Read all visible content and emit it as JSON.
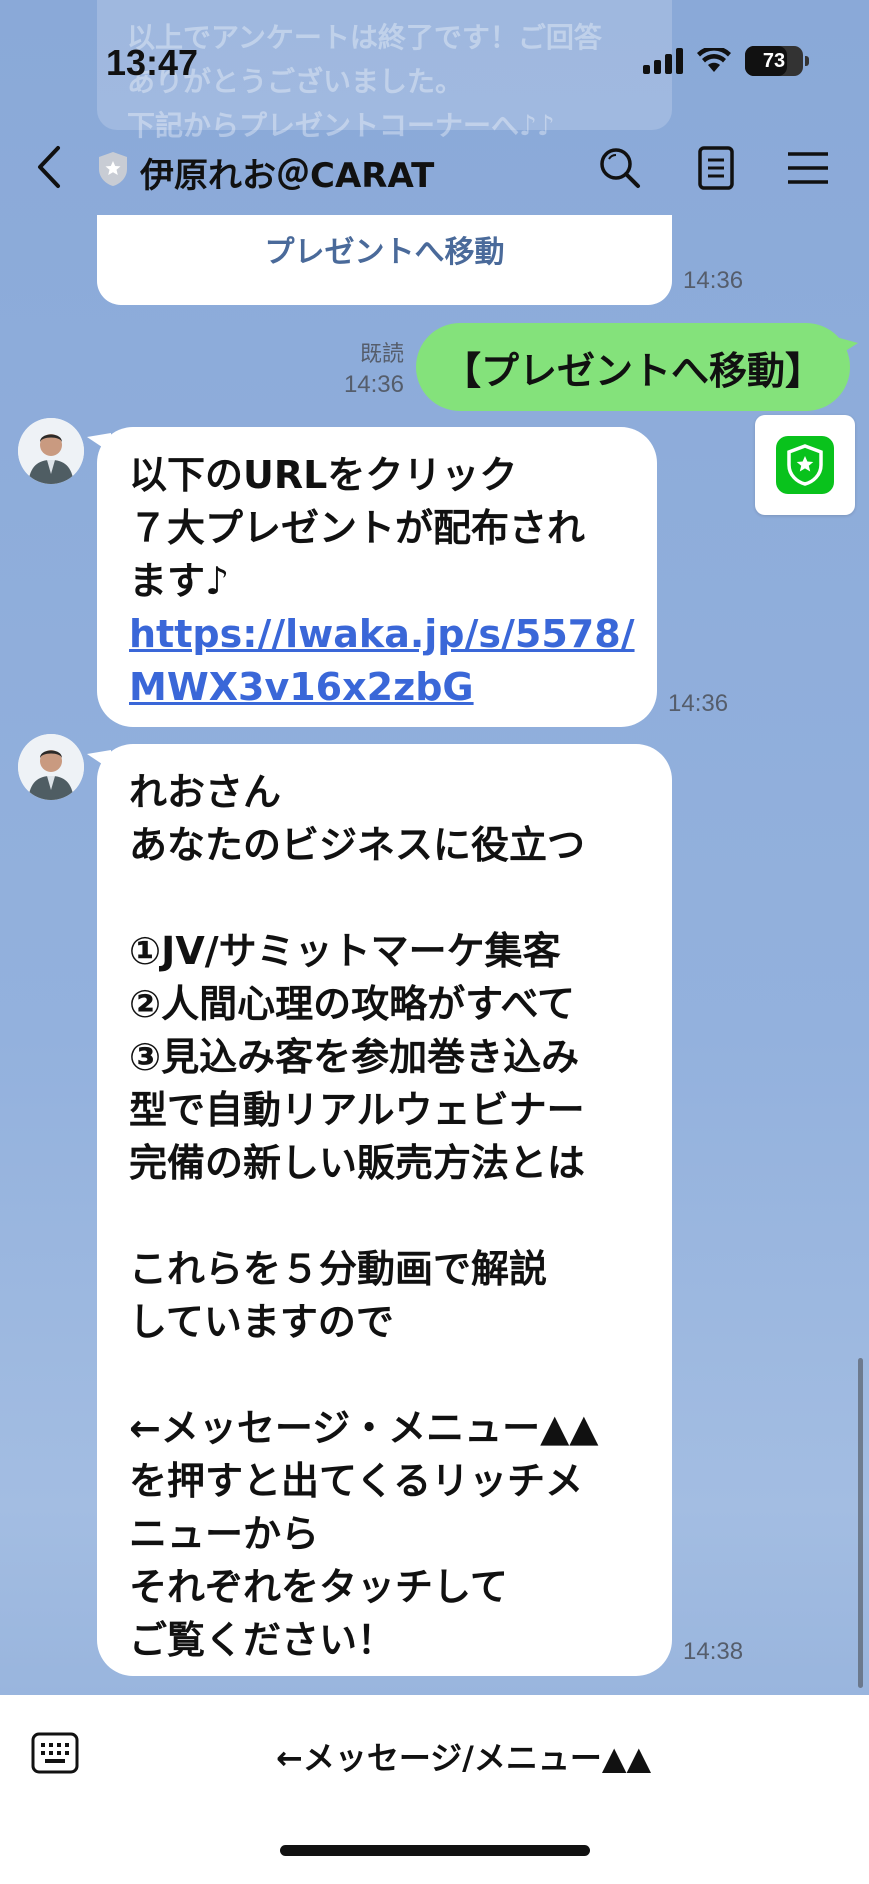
{
  "status_bar": {
    "time": "13:47",
    "battery": "73"
  },
  "background_preview": {
    "lines": "以上でアンケートは終了です！ご回答\nありがとうございました。\n下記からプレゼントコーナーへ♪♪"
  },
  "header": {
    "title": "伊原れお＠CARAT",
    "back_icon": "chevron-left-icon",
    "search_icon": "search-icon",
    "notes_icon": "notes-icon",
    "menu_icon": "hamburger-menu-icon"
  },
  "messages": {
    "top_link": "プレゼントへ移動",
    "top_time": "14:36",
    "mine": {
      "text": "【プレゼントへ移動】",
      "read_label": "既読",
      "time": "14:36"
    },
    "msg1": {
      "lines": [
        "以下のURLをクリック",
        "７大プレゼントが配布され",
        "ます♪"
      ],
      "link_lines": [
        "https://lwaka.jp/s/5578/",
        "MWX3v16x2zbG"
      ],
      "time": "14:36"
    },
    "msg2": {
      "lines": [
        "れおさん",
        "あなたのビジネスに役立つ",
        "",
        "①JV/サミットマーケ集客",
        "②人間心理の攻略がすべて",
        "③見込み客を参加巻き込み",
        "型で自動リアルウェビナー",
        "完備の新しい販売方法とは",
        "",
        "これらを５分動画で解説",
        "していますので",
        "",
        "←メッセージ・メニュー▲▲",
        "を押すと出てくるリッチメ",
        "ニューから",
        "それぞれをタッチして",
        "ご覧ください！"
      ],
      "time": "14:38"
    }
  },
  "bottom_bar": {
    "menu_label": "←メッセージ/メニュー▲▲",
    "keyboard_icon": "keyboard-icon"
  },
  "colors": {
    "background": "#8eacd9",
    "my_bubble": "#84e27b",
    "link": "#3a67d8",
    "shield_green": "#09c21c"
  }
}
